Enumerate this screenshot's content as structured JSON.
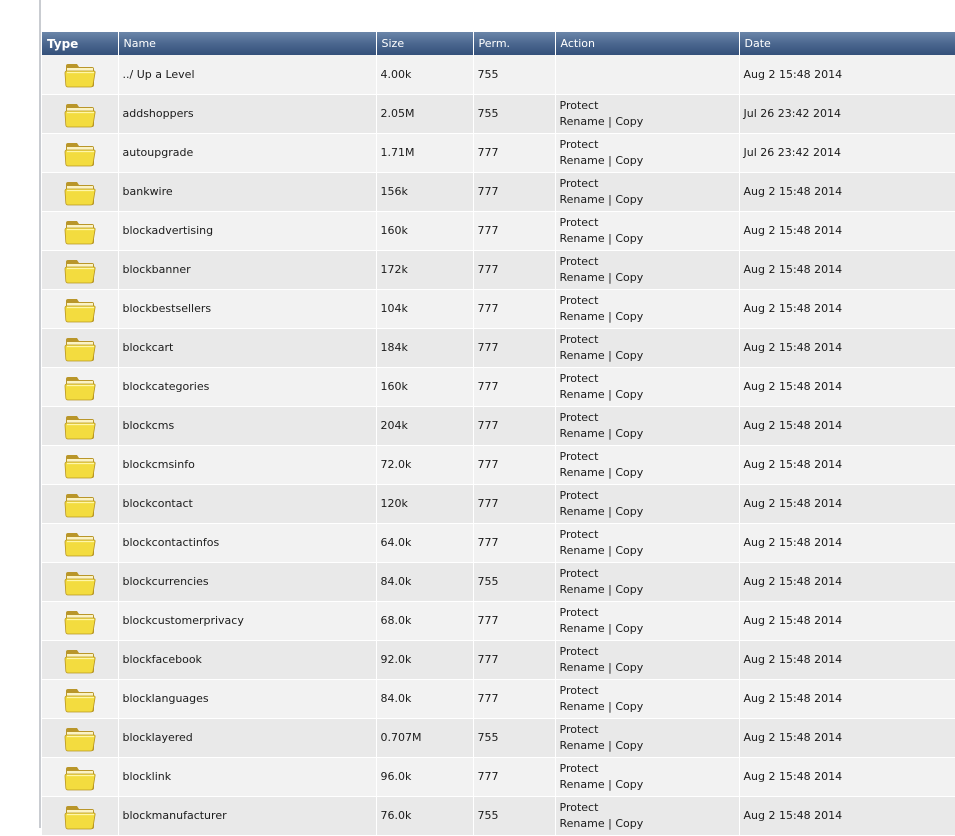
{
  "columns": {
    "type": "Type",
    "name": "Name",
    "size": "Size",
    "perm": "Perm.",
    "action": "Action",
    "date": "Date"
  },
  "actions": {
    "protect": "Protect",
    "rename": "Rename",
    "separator": "|",
    "copy": "Copy"
  },
  "icon": "folder-icon",
  "colors": {
    "header": "#4b678f",
    "row_odd": "#f2f2f2",
    "row_even": "#e9e9e9",
    "folder": "#f4e04a"
  },
  "rows": [
    {
      "name": "../ Up a Level",
      "size": "4.00k",
      "perm": "755",
      "date": "Aug 2 15:48 2014",
      "has_actions": false
    },
    {
      "name": "addshoppers",
      "size": "2.05M",
      "perm": "755",
      "date": "Jul 26 23:42 2014",
      "has_actions": true
    },
    {
      "name": "autoupgrade",
      "size": "1.71M",
      "perm": "777",
      "date": "Jul 26 23:42 2014",
      "has_actions": true
    },
    {
      "name": "bankwire",
      "size": "156k",
      "perm": "777",
      "date": "Aug 2 15:48 2014",
      "has_actions": true
    },
    {
      "name": "blockadvertising",
      "size": "160k",
      "perm": "777",
      "date": "Aug 2 15:48 2014",
      "has_actions": true
    },
    {
      "name": "blockbanner",
      "size": "172k",
      "perm": "777",
      "date": "Aug 2 15:48 2014",
      "has_actions": true
    },
    {
      "name": "blockbestsellers",
      "size": "104k",
      "perm": "777",
      "date": "Aug 2 15:48 2014",
      "has_actions": true
    },
    {
      "name": "blockcart",
      "size": "184k",
      "perm": "777",
      "date": "Aug 2 15:48 2014",
      "has_actions": true
    },
    {
      "name": "blockcategories",
      "size": "160k",
      "perm": "777",
      "date": "Aug 2 15:48 2014",
      "has_actions": true
    },
    {
      "name": "blockcms",
      "size": "204k",
      "perm": "777",
      "date": "Aug 2 15:48 2014",
      "has_actions": true
    },
    {
      "name": "blockcmsinfo",
      "size": "72.0k",
      "perm": "777",
      "date": "Aug 2 15:48 2014",
      "has_actions": true
    },
    {
      "name": "blockcontact",
      "size": "120k",
      "perm": "777",
      "date": "Aug 2 15:48 2014",
      "has_actions": true
    },
    {
      "name": "blockcontactinfos",
      "size": "64.0k",
      "perm": "777",
      "date": "Aug 2 15:48 2014",
      "has_actions": true
    },
    {
      "name": "blockcurrencies",
      "size": "84.0k",
      "perm": "755",
      "date": "Aug 2 15:48 2014",
      "has_actions": true
    },
    {
      "name": "blockcustomerprivacy",
      "size": "68.0k",
      "perm": "777",
      "date": "Aug 2 15:48 2014",
      "has_actions": true
    },
    {
      "name": "blockfacebook",
      "size": "92.0k",
      "perm": "777",
      "date": "Aug 2 15:48 2014",
      "has_actions": true
    },
    {
      "name": "blocklanguages",
      "size": "84.0k",
      "perm": "777",
      "date": "Aug 2 15:48 2014",
      "has_actions": true
    },
    {
      "name": "blocklayered",
      "size": "0.707M",
      "perm": "755",
      "date": "Aug 2 15:48 2014",
      "has_actions": true
    },
    {
      "name": "blocklink",
      "size": "96.0k",
      "perm": "777",
      "date": "Aug 2 15:48 2014",
      "has_actions": true
    },
    {
      "name": "blockmanufacturer",
      "size": "76.0k",
      "perm": "755",
      "date": "Aug 2 15:48 2014",
      "has_actions": true
    }
  ]
}
